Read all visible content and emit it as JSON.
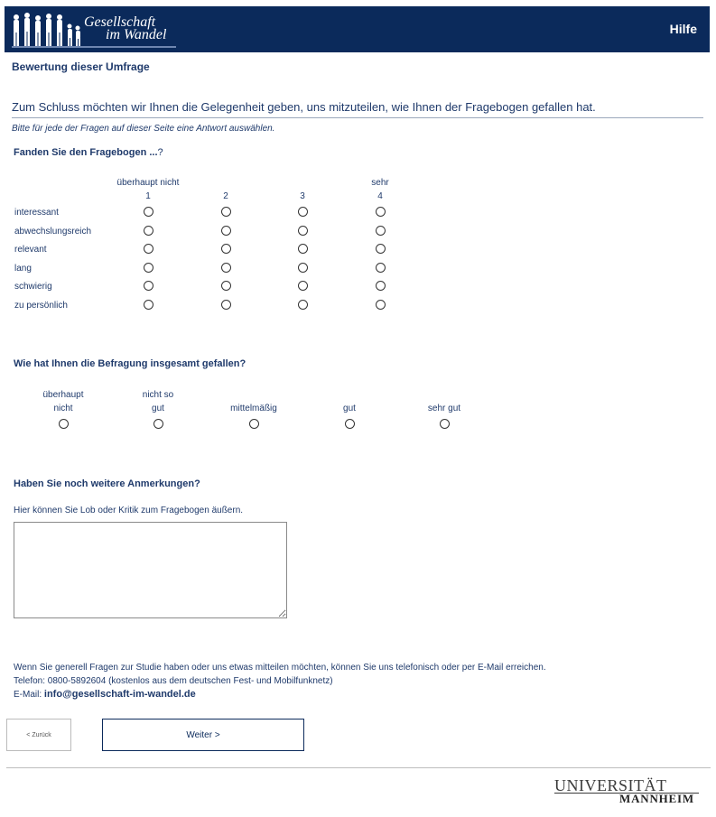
{
  "header": {
    "logo_line1": "Gesellschaft",
    "logo_line2": "im Wandel",
    "help": "Hilfe"
  },
  "page": {
    "title": "Bewertung dieser Umfrage",
    "intro": "Zum Schluss möchten wir Ihnen die Gelegenheit geben, uns mitzuteilen, wie Ihnen der Fragebogen gefallen hat.",
    "instruction": "Bitte für jede der Fragen auf dieser Seite eine Antwort auswählen."
  },
  "q1": {
    "question": "Fanden Sie den Fragebogen ...",
    "suffix": "?",
    "scale_low": "überhaupt nicht",
    "scale_high": "sehr",
    "scale_numbers": [
      "1",
      "2",
      "3",
      "4"
    ],
    "rows": [
      "interessant",
      "abwechslungsreich",
      "relevant",
      "lang",
      "schwierig",
      "zu persönlich"
    ]
  },
  "q2": {
    "question": "Wie hat Ihnen die Befragung insgesamt gefallen?",
    "options": [
      [
        "überhaupt",
        "nicht"
      ],
      [
        "nicht so",
        "gut"
      ],
      [
        "",
        "mittelmäßig"
      ],
      [
        "",
        "gut"
      ],
      [
        "",
        "sehr gut"
      ]
    ]
  },
  "q3": {
    "question": "Haben Sie noch weitere Anmerkungen?",
    "hint": "Hier können Sie Lob oder Kritik zum Fragebogen äußern.",
    "value": ""
  },
  "contact": {
    "line1": "Wenn Sie generell Fragen zur Studie haben oder uns etwas mitteilen möchten, können Sie uns telefonisch oder per E-Mail erreichen.",
    "line2": "Telefon: 0800-5892604 (kostenlos aus dem deutschen Fest- und Mobilfunknetz)",
    "email_label": "E-Mail:",
    "email": "info@gesellschaft-im-wandel.de"
  },
  "nav": {
    "back": "< Zurück",
    "next": "Weiter >"
  },
  "footer": {
    "uni_line1": "UNIVERSITÄT",
    "uni_line2": "MANNHEIM"
  },
  "colors": {
    "header_bg": "#0b2a5b",
    "text": "#1f3a6b"
  }
}
